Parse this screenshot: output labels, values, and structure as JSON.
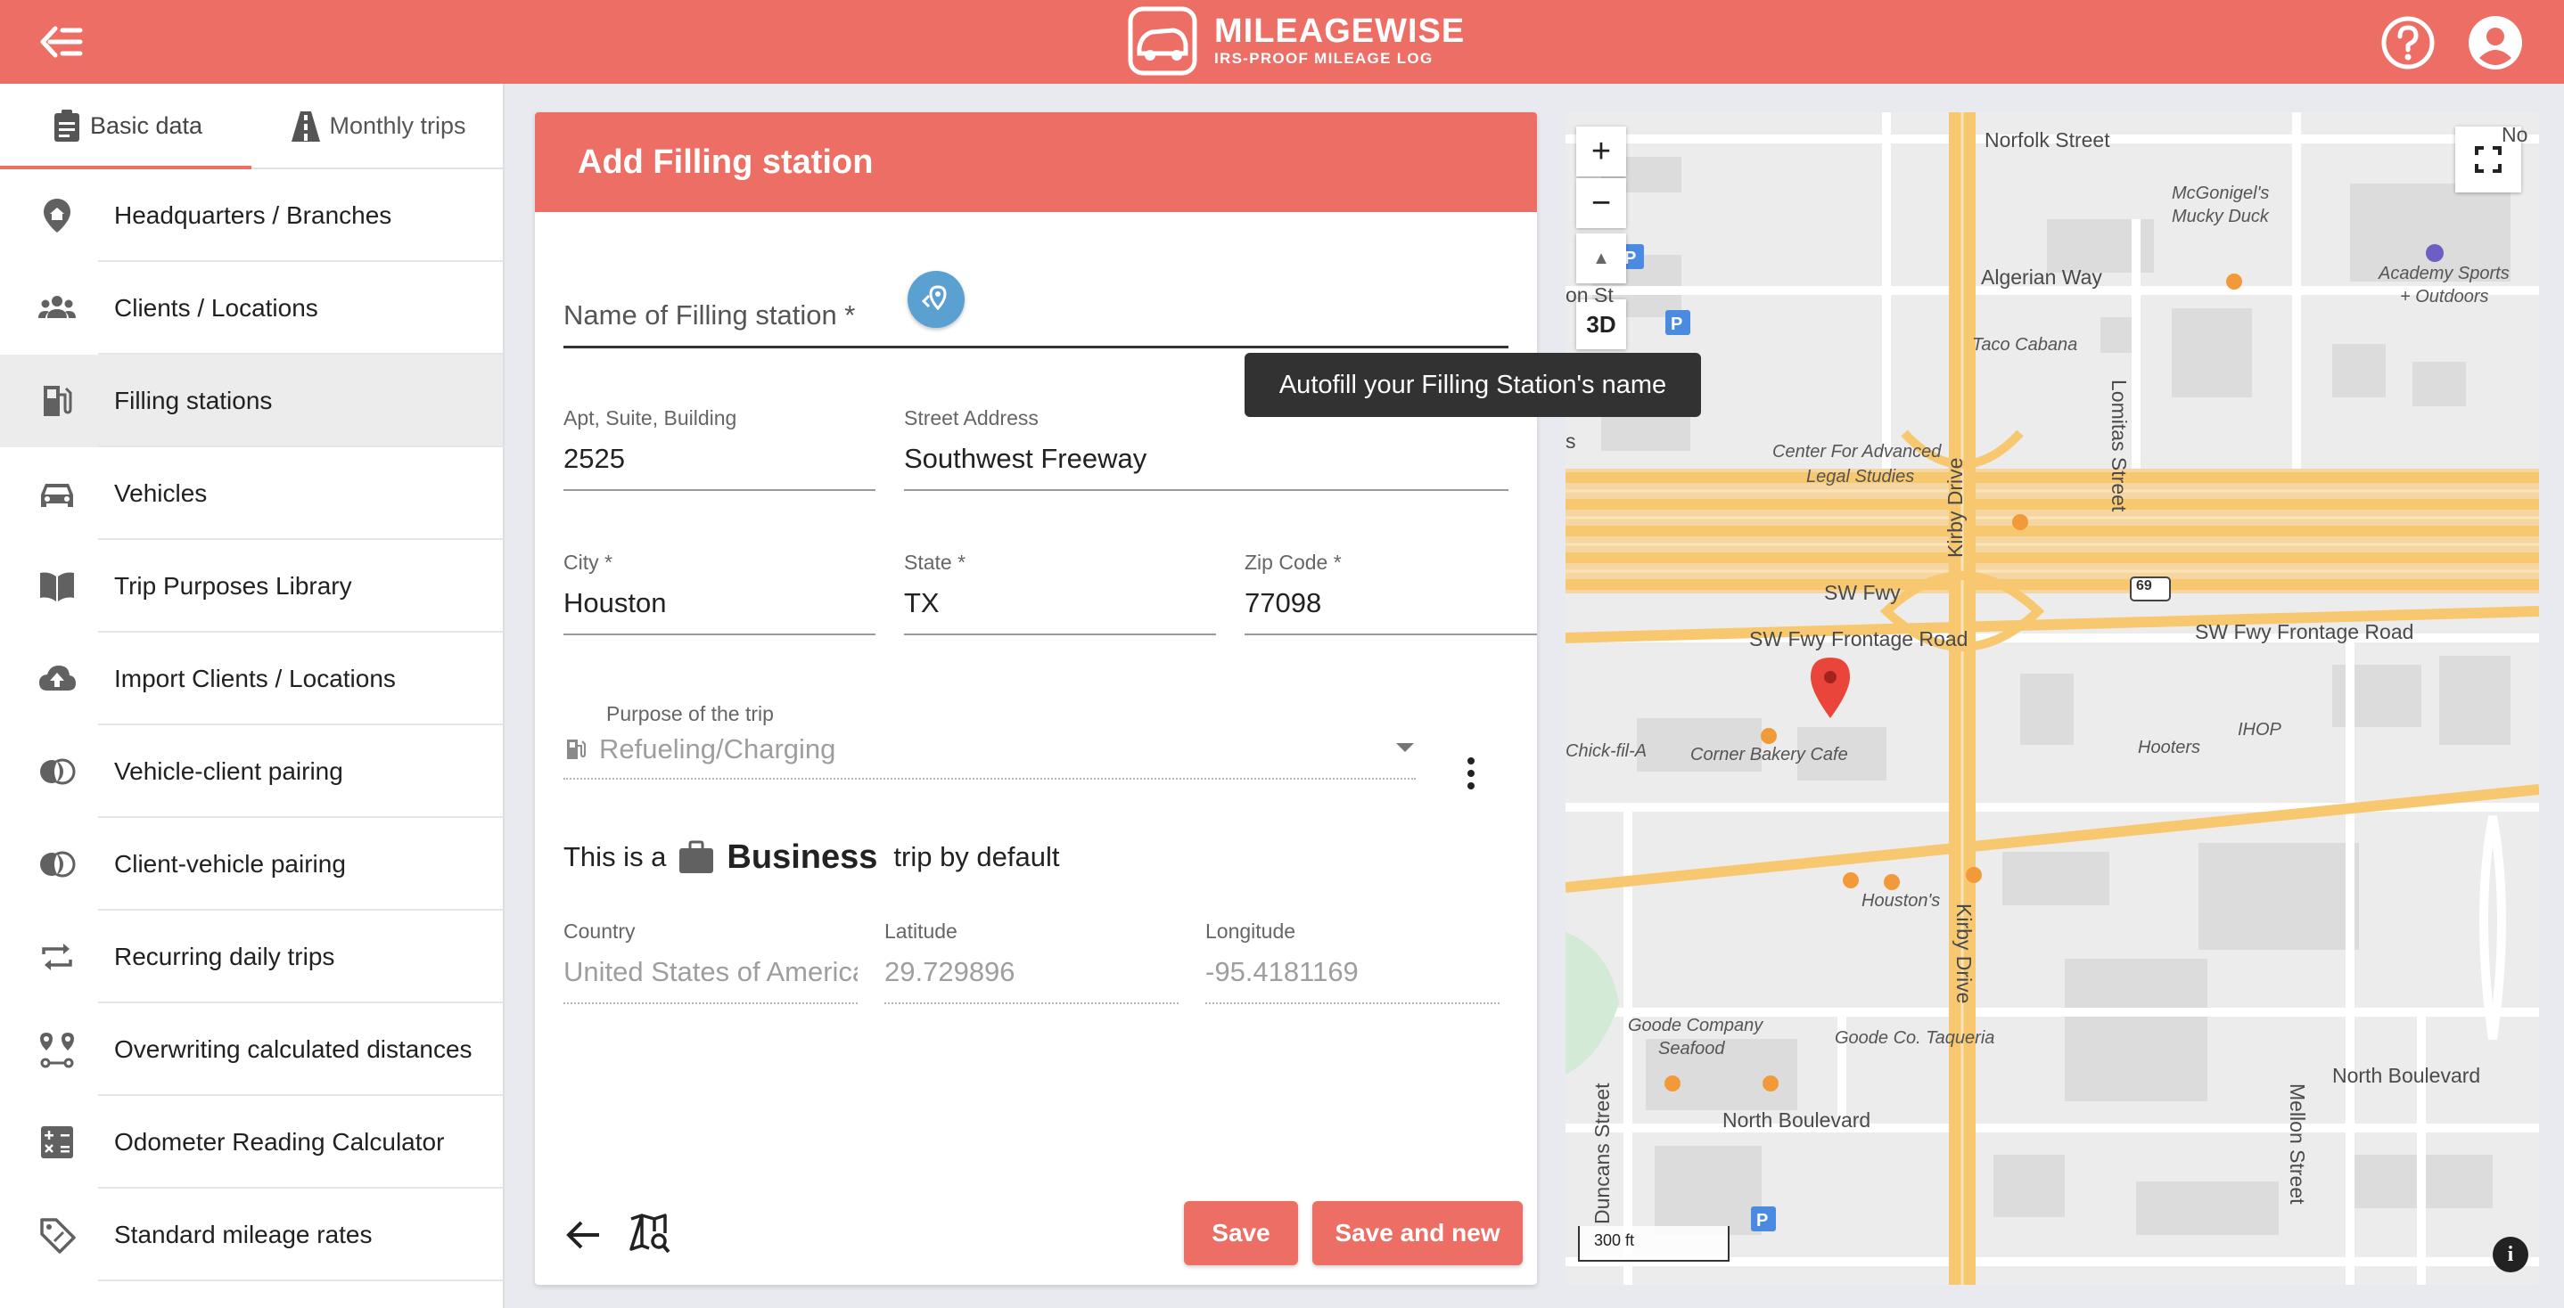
{
  "app": {
    "brand": "MILEAGEWISE",
    "tagline": "IRS-PROOF MILEAGE LOG",
    "accent_color": "#ec6e65"
  },
  "sidebar": {
    "tabs": [
      {
        "label": "Basic data",
        "icon": "clipboard-icon",
        "active": true
      },
      {
        "label": "Monthly trips",
        "icon": "road-icon",
        "active": false
      }
    ],
    "items": [
      {
        "label": "Headquarters / Branches",
        "icon": "home-pin-icon"
      },
      {
        "label": "Clients / Locations",
        "icon": "people-icon"
      },
      {
        "label": "Filling stations",
        "icon": "fuel-icon",
        "active": true
      },
      {
        "label": "Vehicles",
        "icon": "car-icon"
      },
      {
        "label": "Trip Purposes Library",
        "icon": "book-icon"
      },
      {
        "label": "Import Clients / Locations",
        "icon": "cloud-upload-icon"
      },
      {
        "label": "Vehicle-client pairing",
        "icon": "pairing-icon"
      },
      {
        "label": "Client-vehicle pairing",
        "icon": "pairing-icon"
      },
      {
        "label": "Recurring daily trips",
        "icon": "repeat-icon"
      },
      {
        "label": "Overwriting calculated distances",
        "icon": "route-icon"
      },
      {
        "label": "Odometer Reading Calculator",
        "icon": "calculator-icon"
      },
      {
        "label": "Standard mileage rates",
        "icon": "tag-icon"
      }
    ]
  },
  "form": {
    "title": "Add Filling station",
    "name_label": "Name of Filling station *",
    "autofill_tooltip": "Autofill your Filling Station's name",
    "apt": {
      "label": "Apt, Suite, Building",
      "value": "2525"
    },
    "street": {
      "label": "Street Address",
      "value": "Southwest Freeway"
    },
    "city": {
      "label": "City *",
      "value": "Houston"
    },
    "state": {
      "label": "State *",
      "value": "TX"
    },
    "zip": {
      "label": "Zip Code *",
      "value": "77098"
    },
    "purpose": {
      "label": "Purpose of the trip",
      "value": "Refueling/Charging"
    },
    "default_trip": {
      "prefix": "This is a",
      "type": "Business",
      "suffix": "trip by default"
    },
    "country": {
      "label": "Country",
      "value": "United States of America"
    },
    "latitude": {
      "label": "Latitude",
      "value": "29.729896"
    },
    "longitude": {
      "label": "Longitude",
      "value": "-95.4181169"
    },
    "save_label": "Save",
    "save_new_label": "Save and new"
  },
  "map": {
    "zoom_in": "+",
    "zoom_out": "−",
    "compass": "▲",
    "mode_3d": "3D",
    "scale": "300 ft",
    "highway_shield": "69",
    "labels": {
      "norfolk": "Norfolk Street",
      "no_cut": "No",
      "mcgonigels_1": "McGonigel's",
      "mcgonigels_2": "Mucky Duck",
      "algerian": "Algerian Way",
      "academy_1": "Academy Sports",
      "academy_2": "+ Outdoors",
      "taco": "Taco Cabana",
      "lomitas": "Lomitas Street",
      "on_st": "on St",
      "center_1": "Center For Advanced",
      "center_2": "Legal Studies",
      "kirby_1": "Kirby Drive",
      "kirby_2": "Kirby Drive",
      "swfwy": "SW Fwy",
      "frontage_left": "SW Fwy Frontage Road",
      "frontage_right": "SW Fwy Frontage Road",
      "chickfila": "Chick-fil-A",
      "corner": "Corner Bakery Cafe",
      "hooters": "Hooters",
      "ihop": "IHOP",
      "houstons": "Houston's",
      "goode_1": "Goode Company",
      "goode_2": "Seafood",
      "goode_taq": "Goode Co. Taqueria",
      "north_blvd_left": "North Boulevard",
      "north_blvd_right": "North Boulevard",
      "duncans": "Duncans Street",
      "mellon": "Mellon Street",
      "s_cut": "s"
    }
  }
}
